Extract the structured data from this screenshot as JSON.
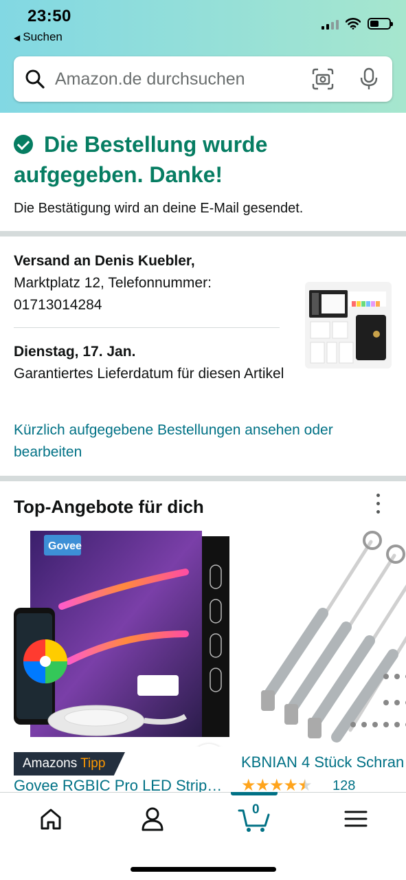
{
  "status_bar": {
    "time": "23:50",
    "back_label": "Suchen"
  },
  "search": {
    "placeholder": "Amazon.de durchsuchen",
    "icons": [
      "search-icon",
      "camera-icon",
      "microphone-icon"
    ]
  },
  "confirmation": {
    "title": "Die Bestellung wurde aufgegeben. Danke!",
    "subtitle": "Die Bestätigung wird an deine E-Mail gesendet."
  },
  "shipping": {
    "recipient": "Versand an Denis Kuebler,",
    "address": "Marktplatz 12, Telefonnummer:",
    "phone": "01713014284",
    "delivery_date": "Dienstag, 17. Jan.",
    "delivery_note": "Garantiertes Lieferdatum für diesen Artikel",
    "orders_link": "Kürzlich aufgegebene Bestellungen ansehen oder bearbeiten"
  },
  "deals": {
    "title": "Top-Angebote für dich",
    "items": [
      {
        "brand_on_box": "Govee",
        "badge_prefix": "Amazons",
        "badge_accent": "Tipp",
        "title": "Govee RGBIC Pro LED Strip…"
      },
      {
        "title": "KBNIAN 4 Stück Schran",
        "rating_stars": 4.5,
        "rating_count": "128"
      }
    ]
  },
  "bottom_nav": {
    "items": [
      "home-icon",
      "account-icon",
      "cart-icon",
      "menu-icon"
    ],
    "cart_count": "0"
  },
  "colors": {
    "success_green": "#067d62",
    "link_teal": "#007185",
    "badge_dark": "#232f3e",
    "badge_accent": "#ff9900",
    "star_orange": "#ffa41c"
  }
}
